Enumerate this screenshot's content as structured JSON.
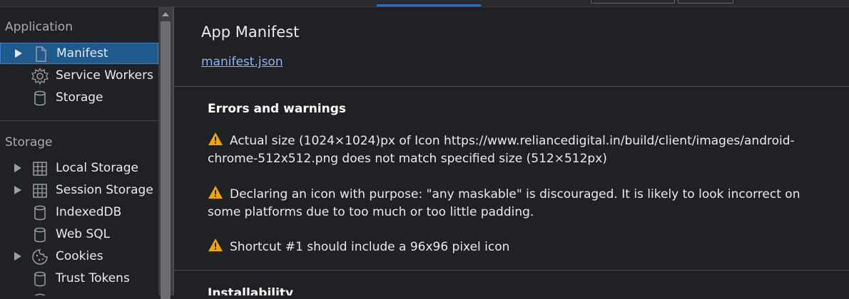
{
  "sidebar": {
    "application_title": "Application",
    "application_items": [
      {
        "label": "Manifest",
        "icon": "document-icon",
        "expandable": true,
        "selected": true
      },
      {
        "label": "Service Workers",
        "icon": "gear-icon",
        "expandable": false
      },
      {
        "label": "Storage",
        "icon": "database-icon",
        "expandable": false
      }
    ],
    "storage_title": "Storage",
    "storage_items": [
      {
        "label": "Local Storage",
        "icon": "grid-icon",
        "expandable": true
      },
      {
        "label": "Session Storage",
        "icon": "grid-icon",
        "expandable": true
      },
      {
        "label": "IndexedDB",
        "icon": "database-icon",
        "expandable": false
      },
      {
        "label": "Web SQL",
        "icon": "database-icon",
        "expandable": false
      },
      {
        "label": "Cookies",
        "icon": "cookie-icon",
        "expandable": true
      },
      {
        "label": "Trust Tokens",
        "icon": "database-icon",
        "expandable": false
      }
    ]
  },
  "main": {
    "title": "App Manifest",
    "manifest_link": "manifest.json",
    "errors_heading": "Errors and warnings",
    "warnings": [
      "Actual size (1024×1024)px of Icon https://www.reliancedigital.in/build/client/images/android-chrome-512x512.png does not match specified size (512×512px)",
      "Declaring an icon with purpose: \"any maskable\" is discouraged. It is likely to look incorrect on some platforms due to too much or too little padding.",
      "Shortcut #1 should include a 96x96 pixel icon"
    ],
    "installability_heading": "Installability"
  },
  "colors": {
    "background": "#202124",
    "selected": "#1f5a8f",
    "link": "#8ab4f8",
    "warning": "#f2a600"
  }
}
